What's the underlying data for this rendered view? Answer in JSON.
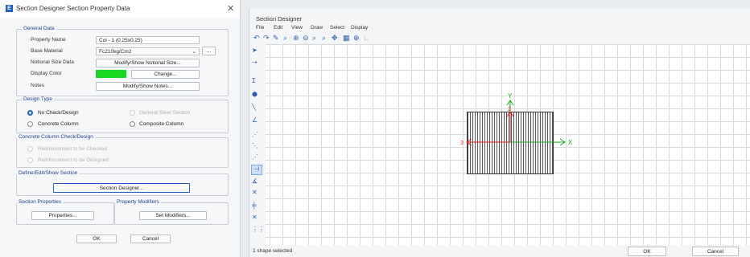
{
  "property_dialog": {
    "title": "Section Designer Section Property Data",
    "app_icon": "E",
    "general": {
      "caption": "General Data",
      "property_name_label": "Property Name",
      "property_name_value": "Col - 1 (0.25x0.25)",
      "base_material_label": "Base Material",
      "base_material_value": "Fc210kg/Cm2",
      "material_more": "...",
      "notional_label": "Notional Size Data",
      "notional_button": "Modify/Show Notional Size...",
      "display_color_label": "Display Color",
      "display_color_value": "#19d61e",
      "change_button": "Change...",
      "notes_label": "Notes",
      "notes_button": "Modify/Show Notes..."
    },
    "design_type": {
      "caption": "Design Type",
      "no_check": "No Check/Design",
      "general_steel": "General Steel Section",
      "concrete_column": "Concrete Column",
      "composite_column": "Composite Column"
    },
    "concrete_check": {
      "caption": "Concrete Column Check/Design",
      "reinf_checked": "Reinforcement to be Checked",
      "reinf_designed": "Reinforcement to be Designed"
    },
    "define_section": {
      "caption": "Define/Edit/Show Section",
      "designer_button": "Section Designer..."
    },
    "section_properties": {
      "caption": "Section Properties",
      "button": "Properties..."
    },
    "property_modifiers": {
      "caption": "Property Modifiers",
      "button": "Set Modifiers..."
    },
    "ok": "OK",
    "cancel": "Cancel"
  },
  "designer": {
    "title": "Section Designer",
    "menus": [
      "File",
      "Edit",
      "View",
      "Draw",
      "Select",
      "Display"
    ],
    "axis_x": "X",
    "axis_y": "Y",
    "label_2": "2",
    "label_3": "3",
    "status": "1 shape selected",
    "ok": "OK",
    "cancel": "Cancel"
  }
}
